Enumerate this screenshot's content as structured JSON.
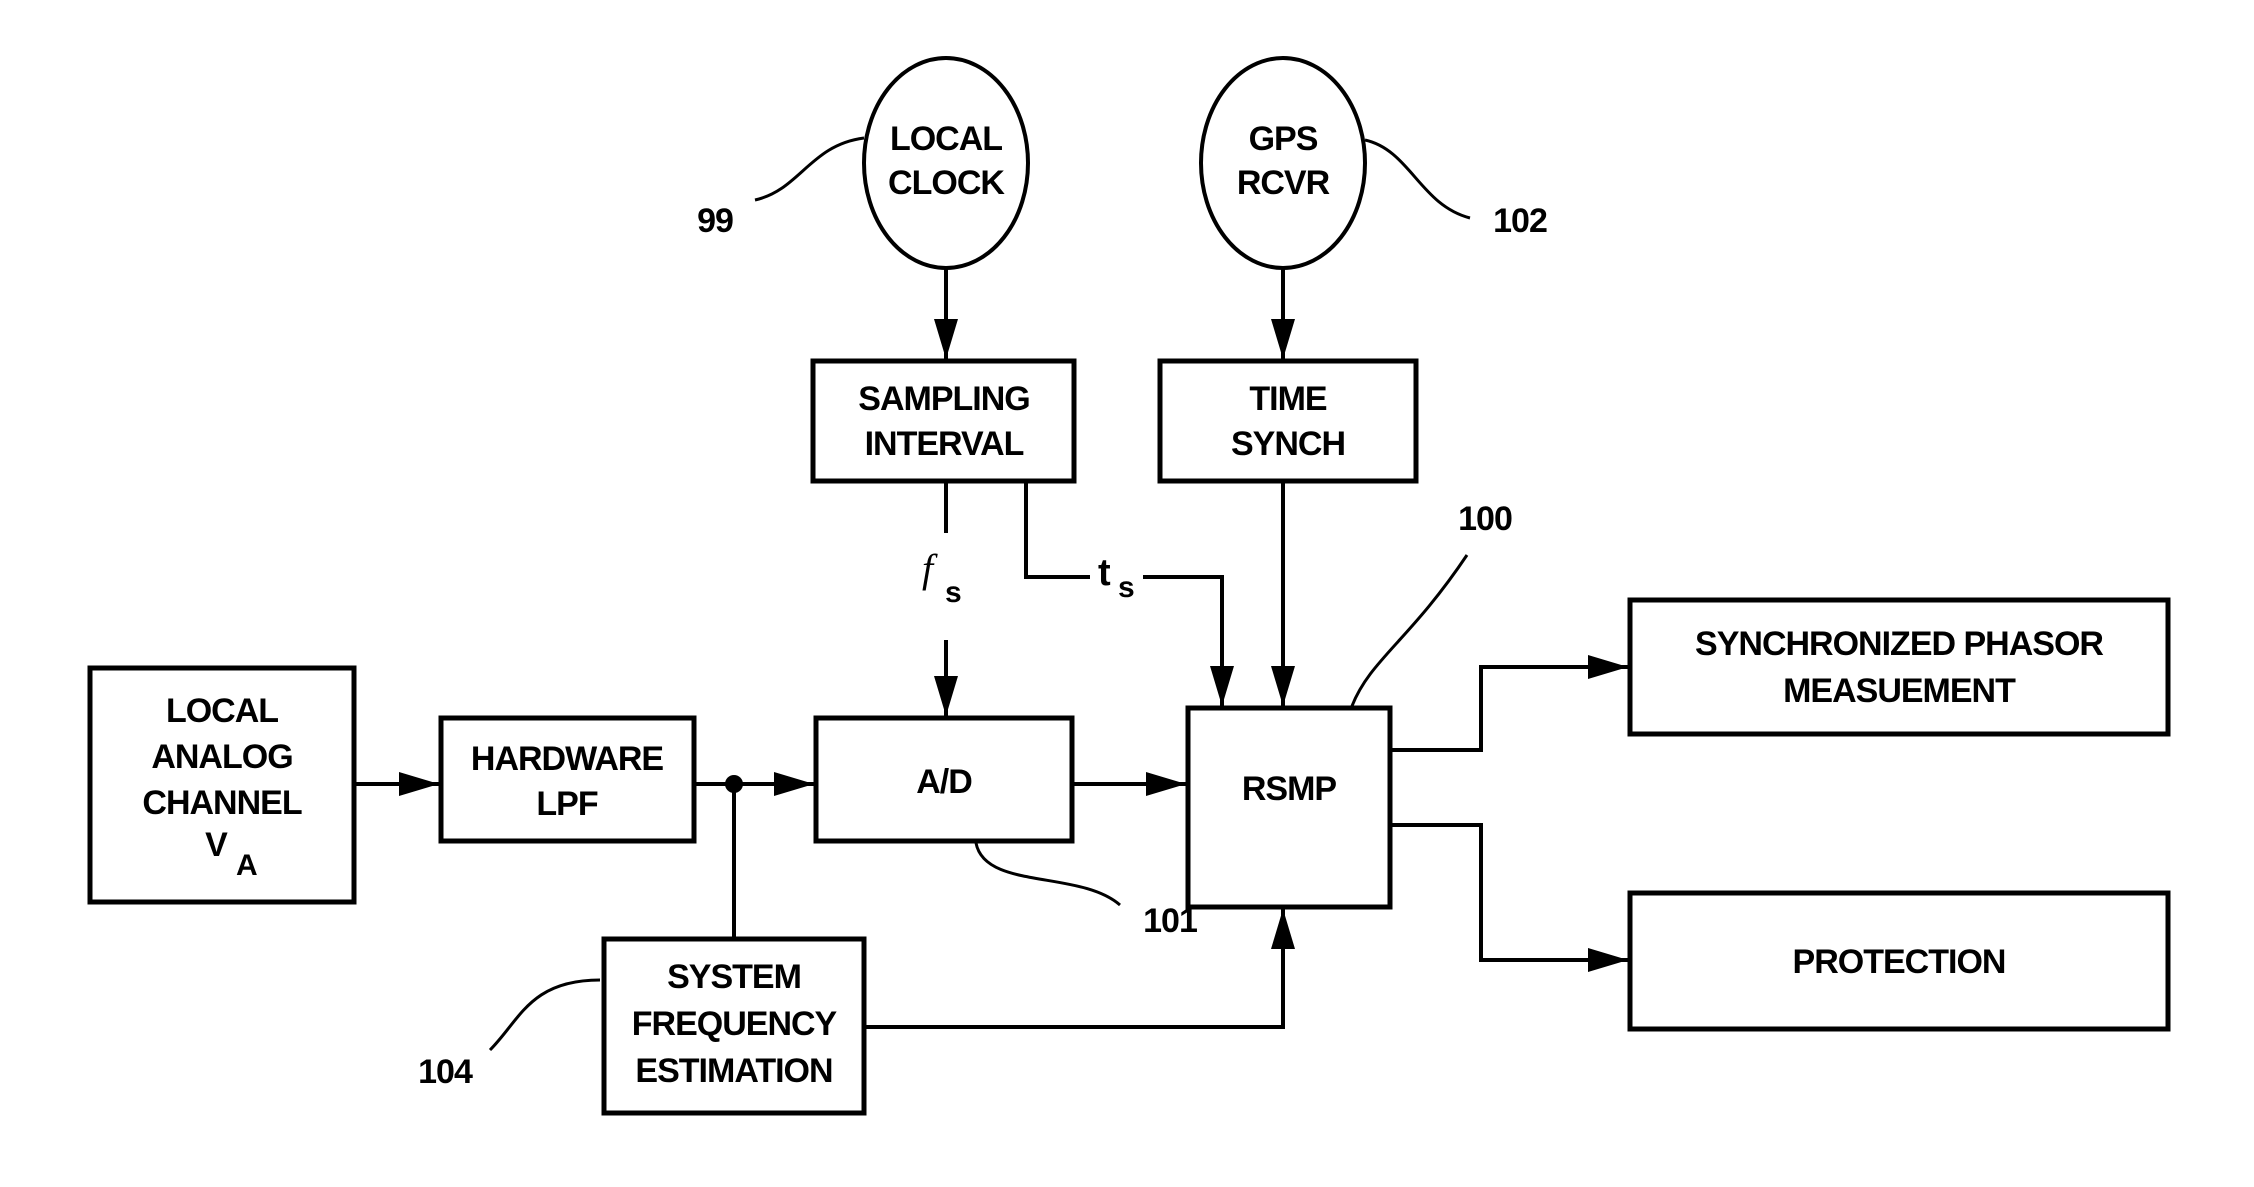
{
  "diagram": {
    "type": "block-diagram",
    "nodes": {
      "local_clock": {
        "lines": [
          "LOCAL",
          "CLOCK"
        ],
        "ref": "99",
        "shape": "circle"
      },
      "gps_rcvr": {
        "lines": [
          "GPS",
          "RCVR"
        ],
        "ref": "102",
        "shape": "circle"
      },
      "sampling_interval": {
        "lines": [
          "SAMPLING",
          "INTERVAL"
        ],
        "shape": "box"
      },
      "time_synch": {
        "lines": [
          "TIME",
          "SYNCH"
        ],
        "shape": "box"
      },
      "local_analog_channel": {
        "lines": [
          "LOCAL",
          "ANALOG",
          "CHANNEL"
        ],
        "symbol": "V",
        "symbol_sub": "A",
        "shape": "box"
      },
      "hardware_lpf": {
        "lines": [
          "HARDWARE",
          "LPF"
        ],
        "shape": "box"
      },
      "ad": {
        "lines": [
          "A/D"
        ],
        "ref": "101",
        "shape": "box"
      },
      "rsmp": {
        "lines": [
          "RSMP"
        ],
        "ref": "100",
        "shape": "box"
      },
      "synchronized_phasor": {
        "lines": [
          "SYNCHRONIZED PHASOR",
          "MEASUEMENT"
        ],
        "shape": "box"
      },
      "protection": {
        "lines": [
          "PROTECTION"
        ],
        "shape": "box"
      },
      "system_frequency": {
        "lines": [
          "SYSTEM",
          "FREQUENCY",
          "ESTIMATION"
        ],
        "ref": "104",
        "shape": "box"
      }
    },
    "signals": {
      "fs": {
        "symbol": "f",
        "sub": "s"
      },
      "ts": {
        "symbol": "t",
        "sub": "s"
      }
    },
    "edges": [
      {
        "from": "local_clock",
        "to": "sampling_interval"
      },
      {
        "from": "gps_rcvr",
        "to": "time_synch"
      },
      {
        "from": "sampling_interval",
        "to": "ad",
        "label": "fs"
      },
      {
        "from": "sampling_interval",
        "to": "rsmp",
        "label": "ts"
      },
      {
        "from": "time_synch",
        "to": "rsmp"
      },
      {
        "from": "local_analog_channel",
        "to": "hardware_lpf"
      },
      {
        "from": "hardware_lpf",
        "to": "ad"
      },
      {
        "from": "hardware_lpf",
        "to": "system_frequency"
      },
      {
        "from": "ad",
        "to": "rsmp"
      },
      {
        "from": "system_frequency",
        "to": "rsmp"
      },
      {
        "from": "rsmp",
        "to": "synchronized_phasor"
      },
      {
        "from": "rsmp",
        "to": "protection"
      }
    ]
  }
}
